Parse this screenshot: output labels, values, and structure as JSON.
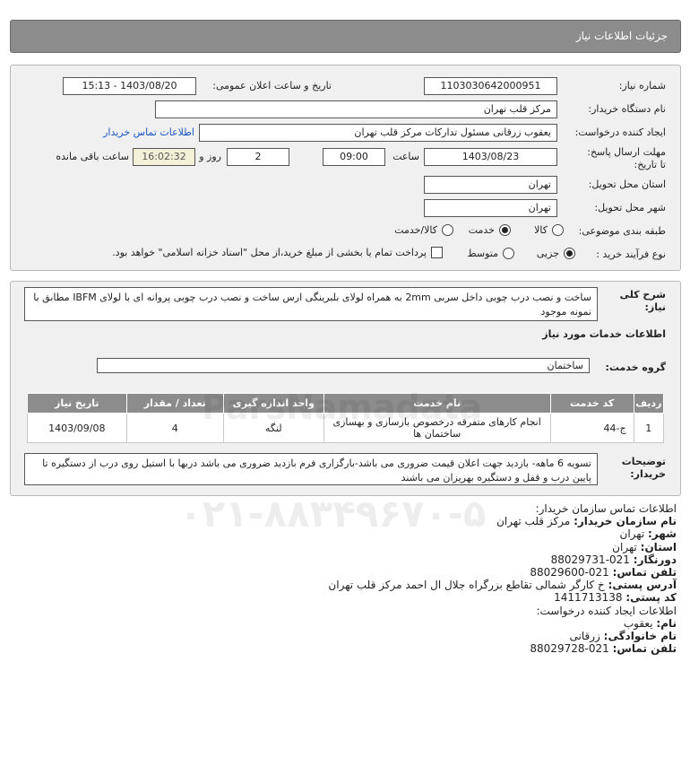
{
  "page_title": "جزئیات اطلاعات نیاز",
  "form": {
    "need_number_label": "شماره نیاز:",
    "need_number": "1103030642000951",
    "announce_label": "تاریخ و ساعت اعلان عمومی:",
    "announce_value": "1403/08/20 - 15:13",
    "buyer_org_label": "نام دستگاه خریدار:",
    "buyer_org": "مرکز قلب تهران",
    "creator_label": "ایجاد کننده درخواست:",
    "creator": "یعقوب زرقانی مسئول تدارکات مرکز قلب تهران",
    "contact_link": "اطلاعات تماس خریدار",
    "deadline_label": "مهلت ارسال پاسخ: تا تاریخ:",
    "deadline_date": "1403/08/23",
    "time_label": "ساعت",
    "deadline_time": "09:00",
    "days_value": "2",
    "days_label": "روز و",
    "remaining_time": "16:02:32",
    "remaining_label": "ساعت باقی مانده",
    "province_label": "استان محل تحویل:",
    "province": "تهران",
    "city_label": "شهر محل تحویل:",
    "city": "تهران",
    "category_label": "طبقه بندی موضوعی:",
    "category_options": [
      "کالا",
      "خدمت",
      "کالا/خدمت"
    ],
    "category_selected": "خدمت",
    "process_label": "نوع فرآیند خرید :",
    "process_options": [
      "جزیی",
      "متوسط"
    ],
    "process_selected": "جزیی",
    "payment_note": "پرداخت تمام یا بخشی از مبلغ خرید،از محل \"اسناد خزانه اسلامی\" خواهد بود."
  },
  "description": {
    "label": "شرح کلی نیاز:",
    "text": "ساخت و نصب درب چوبی داخل سربی 2mm به همراه لولای بلبرینگی ارس ساخت و نصب درب چوبی پروانه ای با لولای IBFM مطابق با نمونه موجود"
  },
  "services": {
    "section_title": "اطلاعات خدمات مورد نیاز",
    "group_label": "گروه خدمت:",
    "group_value": "ساختمان",
    "table": {
      "headers": [
        "ردیف",
        "کد خدمت",
        "نام خدمت",
        "واحد اندازه گیری",
        "تعداد / مقدار",
        "تاریخ نیاز"
      ],
      "rows": [
        [
          "1",
          "ج-44",
          "انجام کارهای متفرقه درخصوص بازسازی و بهسازی ساختمان ها",
          "لنگه",
          "4",
          "1403/09/08"
        ]
      ]
    }
  },
  "buyer_notes": {
    "label": "توضیحات خریدار:",
    "text": "تسویه 6 ماهه- بازدید جهت اعلان قیمت ضروری می باشد-بارگزاری فرم بازدید ضروری می باشد دربها با استیل روی درب از دستگیره تا پایین درب و قفل و دستگیره بهریزان می باشند"
  },
  "contact": {
    "buyer_section": "اطلاعات تماس سازمان خریدار:",
    "org_key": "نام سازمان خریدار:",
    "org_val": "مرکز قلب تهران",
    "city_key": "شهر:",
    "city_val": "تهران",
    "province_key": "استان:",
    "province_val": "تهران",
    "fax_key": "دورنگار:",
    "fax_val": "021-88029731",
    "phone_key": "تلفن تماس:",
    "phone_val": "021-88029600",
    "address_key": "آدرس پستی:",
    "address_val": "خ کارگر شمالی تقاطع بزرگراه جلال ال احمد مرکز قلب تهران",
    "postal_key": "کد پستی:",
    "postal_val": "1411713138",
    "creator_section": "اطلاعات ایجاد کننده درخواست:",
    "name_key": "نام:",
    "name_val": "یعقوب",
    "family_key": "نام خانوادگی:",
    "family_val": "زرقانی",
    "cphone_key": "تلفن تماس:",
    "cphone_val": "021-88029728"
  },
  "watermark": {
    "brand": "ParsNamadata",
    "phone": "۰۲۱-۸۸۳۴۹۶۷۰-۵"
  }
}
